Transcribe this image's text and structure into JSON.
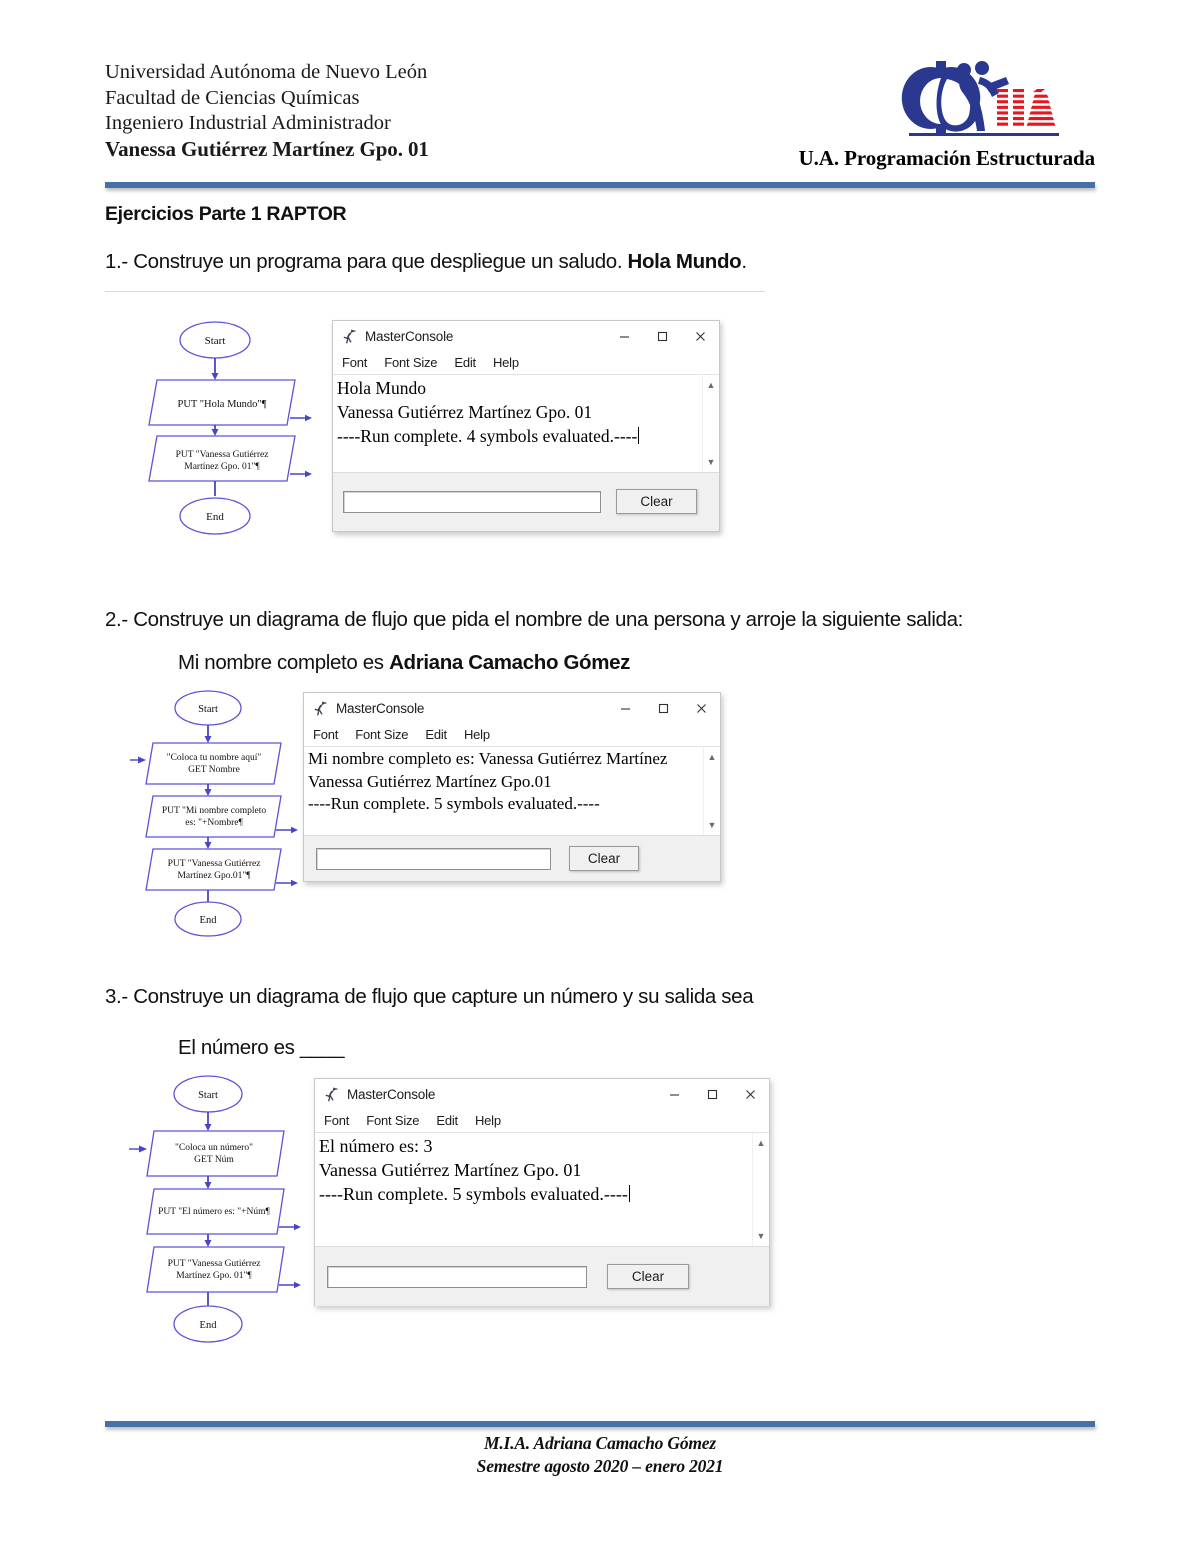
{
  "header": {
    "line1": "Universidad Autónoma de Nuevo León",
    "line2": "Facultad de Ciencias Químicas",
    "line3": "Ingeniero Industrial Administrador",
    "line4": "Vanessa Gutiérrez Martínez Gpo. 01",
    "right_title": "U.A. Programación Estructurada",
    "logo_text": "IIA",
    "logo_name": "iia-logo",
    "rule_color": "#4472A4"
  },
  "body": {
    "section_title": "Ejercicios Parte 1 RAPTOR",
    "q1_prefix": "1.- Construye un programa para que despliegue un saludo. ",
    "q1_bold": "Hola Mundo",
    "q1_suffix": ".",
    "q2": "2.- Construye un diagrama de flujo que pida el nombre de una persona y arroje la siguiente salida:",
    "q2_sub_prefix": "Mi nombre completo es ",
    "q2_sub_bold": "Adriana Camacho Gómez",
    "q3": "3.- Construye un diagrama de flujo que capture un número y su salida sea",
    "q3_sub": "El número es ____"
  },
  "footer": {
    "line1": "M.I.A. Adriana Camacho Gómez",
    "line2": "Semestre agosto 2020 – enero 2021"
  },
  "flowcharts": [
    {
      "id": "flowchart-1",
      "start_label": "Start",
      "end_label": "End",
      "nodes": [
        {
          "type": "output",
          "lines": [
            "PUT \"Hola Mundo\"¶"
          ]
        },
        {
          "type": "output",
          "lines": [
            "PUT \"Vanessa Gutiérrez",
            "Martínez Gpo. 01\"¶"
          ]
        }
      ],
      "shape_color": "#5b54d6"
    },
    {
      "id": "flowchart-2",
      "start_label": "Start",
      "end_label": "End",
      "nodes": [
        {
          "type": "input",
          "lines": [
            "\"Coloca tu nombre aquí\"",
            "GET Nombre"
          ]
        },
        {
          "type": "output",
          "lines": [
            "PUT \"Mi nombre completo",
            "es: \"+Nombre¶"
          ]
        },
        {
          "type": "output",
          "lines": [
            "PUT \"Vanessa Gutiérrez",
            "Martínez Gpo.01\"¶"
          ]
        }
      ],
      "shape_color": "#5b54d6"
    },
    {
      "id": "flowchart-3",
      "start_label": "Start",
      "end_label": "End",
      "nodes": [
        {
          "type": "input",
          "lines": [
            "\"Coloca un número\"",
            "GET Núm"
          ]
        },
        {
          "type": "output",
          "lines": [
            "PUT \"El número es: \"+Núm¶"
          ]
        },
        {
          "type": "output",
          "lines": [
            "PUT \"Vanessa Gutiérrez",
            "Martínez Gpo. 01\"¶"
          ]
        }
      ],
      "shape_color": "#5b54d6"
    }
  ],
  "consoles": [
    {
      "id": "console-1",
      "title": "MasterConsole",
      "menus": [
        "Font",
        "Font Size",
        "Edit",
        "Help"
      ],
      "output": [
        "Hola Mundo",
        "Vanessa Gutiérrez Martínez Gpo. 01",
        "----Run complete.  4 symbols evaluated.----"
      ],
      "has_caret": true,
      "input_value": "",
      "clear_label": "Clear",
      "minimize_label": "—",
      "maximize_label": "□",
      "close_label": "✕"
    },
    {
      "id": "console-2",
      "title": "MasterConsole",
      "menus": [
        "Font",
        "Font Size",
        "Edit",
        "Help"
      ],
      "output": [
        "Mi nombre completo es: Vanessa Gutiérrez Martínez",
        "Vanessa Gutiérrez Martínez Gpo.01",
        "----Run complete.  5 symbols evaluated.----"
      ],
      "has_caret": false,
      "input_value": "",
      "clear_label": "Clear",
      "minimize_label": "—",
      "maximize_label": "□",
      "close_label": "✕"
    },
    {
      "id": "console-3",
      "title": "MasterConsole",
      "menus": [
        "Font",
        "Font Size",
        "Edit",
        "Help"
      ],
      "output": [
        "El número es: 3",
        "Vanessa Gutiérrez Martínez Gpo. 01",
        "----Run complete.  5 symbols evaluated.----"
      ],
      "has_caret": true,
      "input_value": "",
      "clear_label": "Clear",
      "minimize_label": "—",
      "maximize_label": "□",
      "close_label": "✕"
    }
  ]
}
